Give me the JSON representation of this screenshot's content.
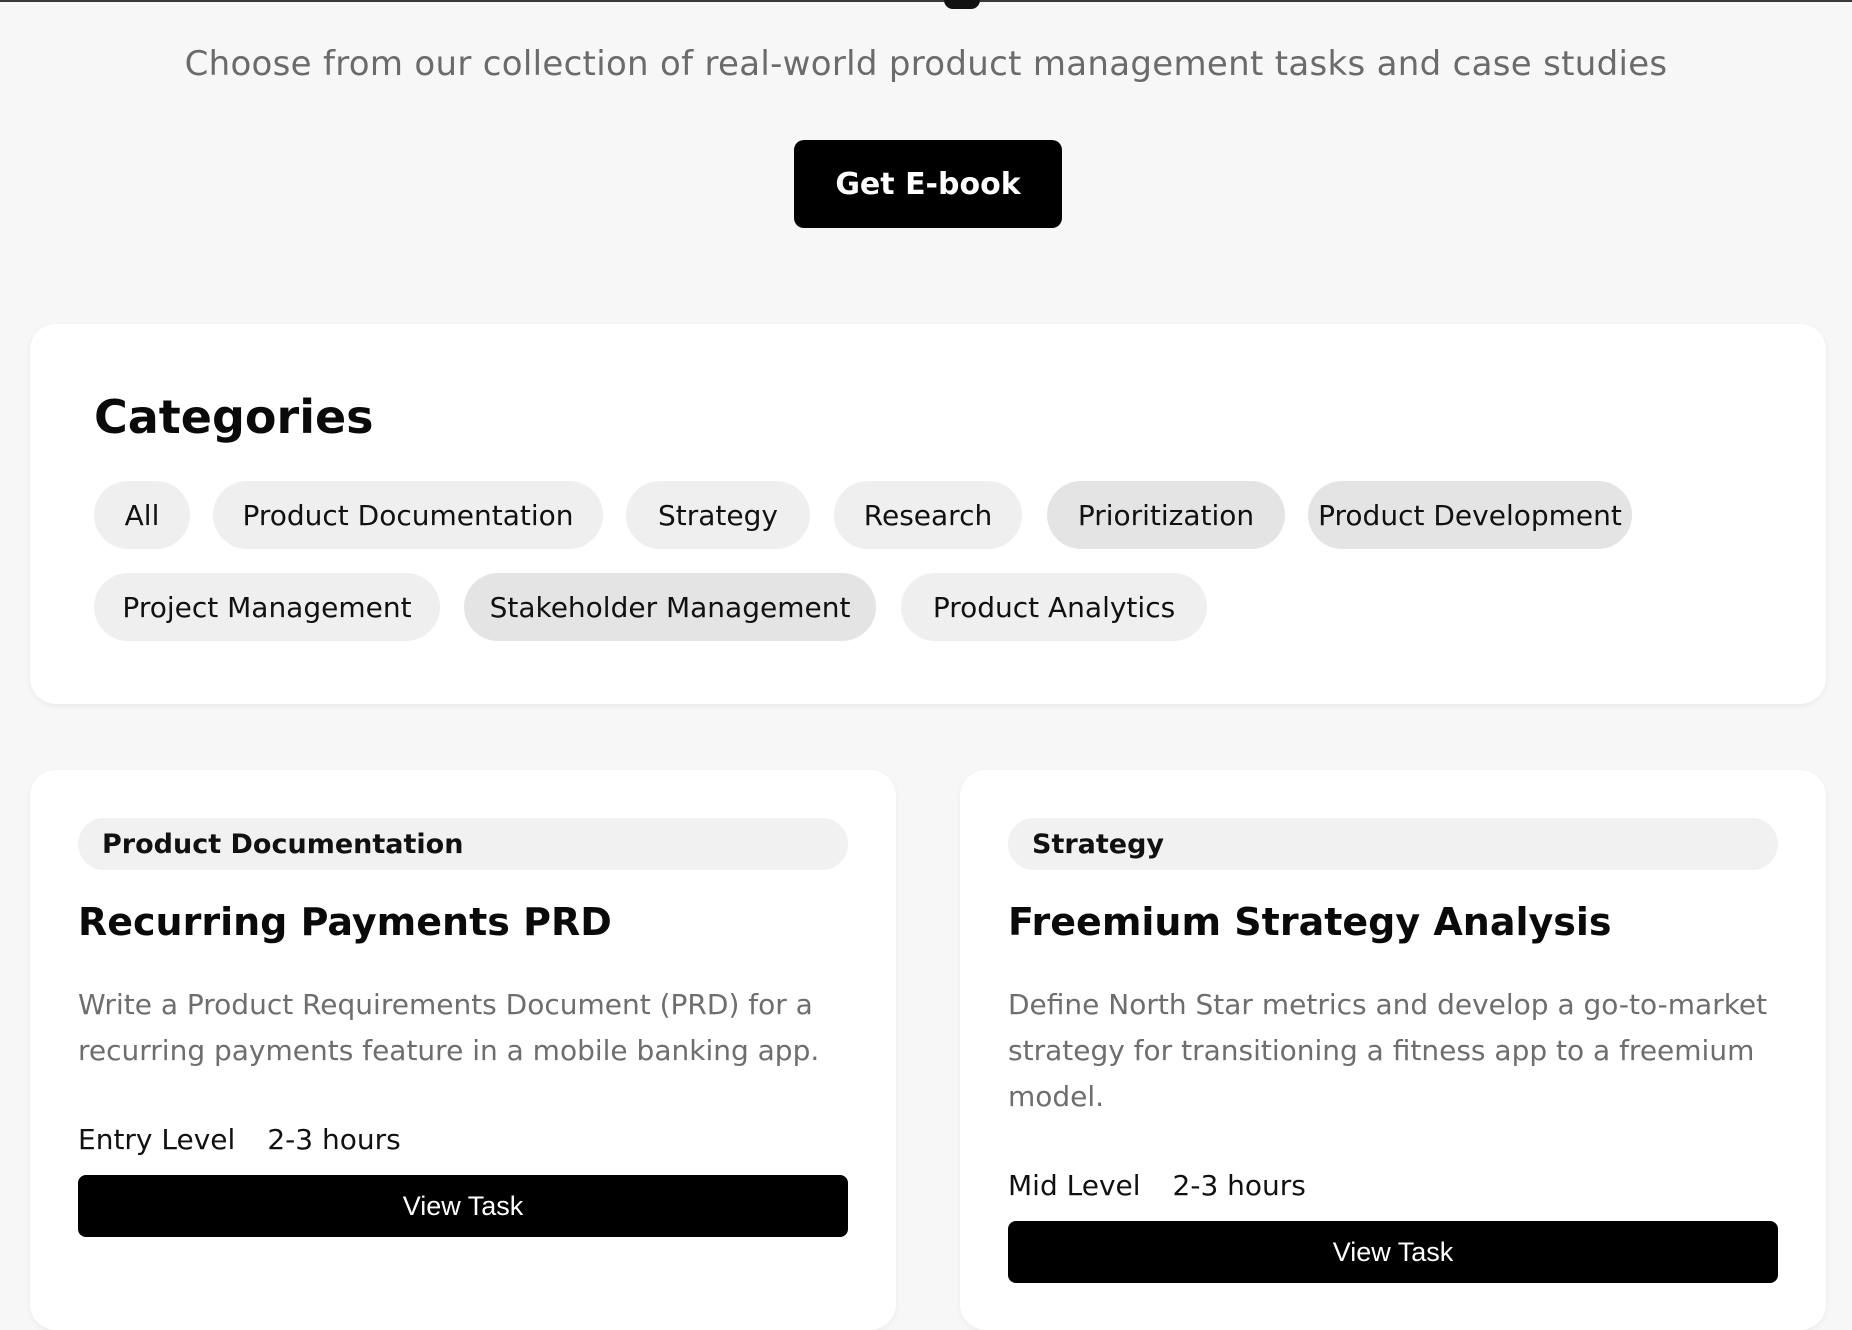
{
  "header": {
    "subtitle": "Choose from our collection of real-world product management tasks and case studies",
    "ebook_label": "Get E-book"
  },
  "categories": {
    "title": "Categories",
    "items": [
      "All",
      "Product Documentation",
      "Strategy",
      "Research",
      "Prioritization",
      "Product Development",
      "Project Management",
      "Stakeholder Management",
      "Product Analytics"
    ]
  },
  "tasks": [
    {
      "tag": "Product Documentation",
      "title": "Recurring Payments PRD",
      "description": "Write a Product Requirements Document (PRD) for a recurring payments feature in a mobile banking app.",
      "level": "Entry Level",
      "duration": "2-3 hours",
      "button": "View Task"
    },
    {
      "tag": "Strategy",
      "title": "Freemium Strategy Analysis",
      "description": "Define North Star metrics and develop a go-to-market strategy for transitioning a fitness app to a freemium model.",
      "level": "Mid Level",
      "duration": "2-3 hours",
      "button": "View Task"
    }
  ]
}
